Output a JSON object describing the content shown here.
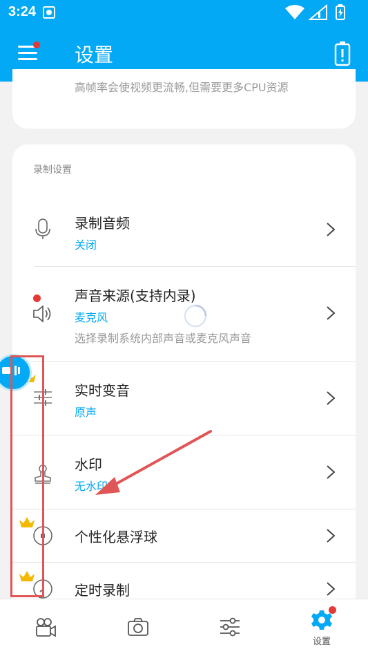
{
  "status_bar": {
    "time": "3:24"
  },
  "header": {
    "title": "设置"
  },
  "top_card": {
    "description": "高帧率会使视频更流畅,但需要更多CPU资源"
  },
  "recording_section": {
    "title": "录制设置",
    "items": [
      {
        "label": "录制音频",
        "value": "关闭",
        "hint": "",
        "icon": "microphone-icon"
      },
      {
        "label": "声音来源(支持内录)",
        "value": "麦克风",
        "hint": "选择录制系统内部声音或麦克风声音",
        "icon": "speaker-icon"
      },
      {
        "label": "实时变音",
        "value": "原声",
        "hint": "",
        "icon": "sliders-icon"
      },
      {
        "label": "水印",
        "value": "无水印",
        "hint": "",
        "icon": "stamp-icon"
      },
      {
        "label": "个性化悬浮球",
        "value": "",
        "hint": "",
        "icon": "floating-ball-icon"
      },
      {
        "label": "定时录制",
        "value": "",
        "hint": "",
        "icon": "clock-icon"
      }
    ]
  },
  "bottom_nav": {
    "items": [
      {
        "icon": "video-camera-icon",
        "label": ""
      },
      {
        "icon": "camera-icon",
        "label": ""
      },
      {
        "icon": "tools-sliders-icon",
        "label": ""
      },
      {
        "icon": "gear-icon",
        "label": "设置"
      }
    ]
  },
  "colors": {
    "accent": "#03a9f4",
    "badge": "#e53935",
    "crown": "#f5b800",
    "annotation": "#e05555"
  }
}
